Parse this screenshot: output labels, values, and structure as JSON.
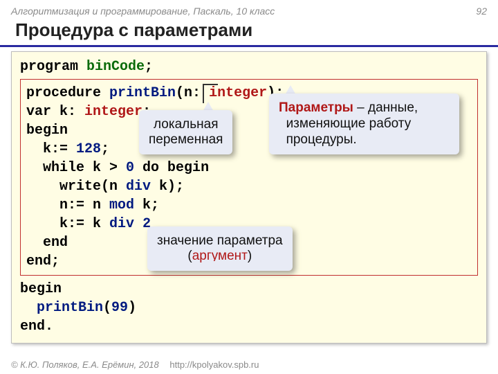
{
  "header": {
    "course": "Алгоритмизация и программирование, Паскаль, 10 класс",
    "page": "92"
  },
  "title": "Процедура с параметрами",
  "code": {
    "l1_kw": "program ",
    "l1_name": "binCode",
    "l1_end": ";",
    "p1_a": "procedure ",
    "p1_b": "printBin",
    "p1_c": "(n: ",
    "p1_d": "integer",
    "p1_e": ");",
    "p2_a": "var k: ",
    "p2_b": "integer",
    "p2_c": ";",
    "p3": "begin",
    "p4_a": "  k:= ",
    "p4_b": "128",
    "p4_c": ";",
    "p5_a": "  while k > ",
    "p5_b": "0",
    "p5_c": " do begin",
    "p6_a": "    write(n ",
    "p6_b": "div",
    "p6_c": " k);",
    "p7_a": "    n:= n ",
    "p7_b": "mod",
    "p7_c": " k;",
    "p8_a": "    k:= k ",
    "p8_b": "div",
    "p8_c": " ",
    "p8_d": "2",
    "p9": "  end",
    "p10": "end;",
    "m1": "begin",
    "m2_a": "  ",
    "m2_b": "printBin",
    "m2_c": "(",
    "m2_d": "99",
    "m2_e": ")",
    "m3": "end."
  },
  "callouts": {
    "local_l1": "локальная",
    "local_l2": "переменная",
    "params_l1a": "Параметры",
    "params_l1b": " – данные,",
    "params_l2": "изменяющие работу",
    "params_l3": "процедуры.",
    "arg_l1": "значение параметра",
    "arg_l2a": "(",
    "arg_l2b": "аргумент",
    "arg_l2c": ")"
  },
  "footer": {
    "authors": "© К.Ю. Поляков, Е.А. Ерёмин, 2018",
    "url": "http://kpolyakov.spb.ru"
  }
}
